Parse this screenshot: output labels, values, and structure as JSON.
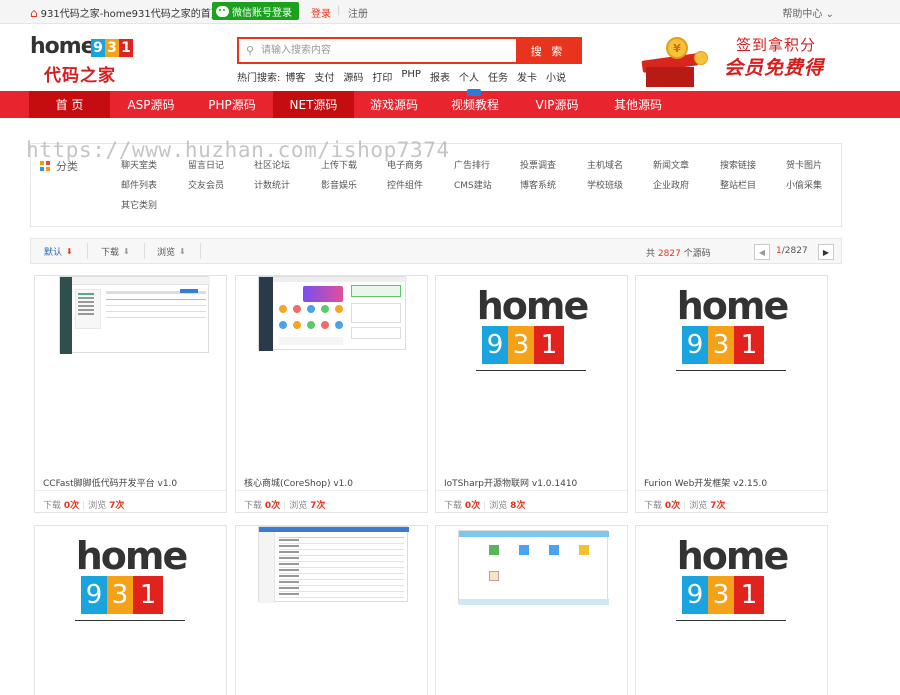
{
  "topbar": {
    "site_link": "931代码之家-home931代码之家的首页",
    "wechat_login": "微信账号登录",
    "login": "登录",
    "separator": "|",
    "register": "注册",
    "help": "帮助中心"
  },
  "logo": {
    "word": "home",
    "digits": [
      "9",
      "3",
      "1"
    ],
    "slogan": "代码之家"
  },
  "search": {
    "placeholder": "请输入搜索内容",
    "button": "搜 索",
    "hot_label": "热门搜索:",
    "hot_terms": [
      "博客",
      "支付",
      "源码",
      "打印",
      "PHP",
      "报表",
      "个人",
      "任务",
      "发卡",
      "小说"
    ]
  },
  "promo": {
    "line1": "签到拿积分",
    "line2": "会员免费得",
    "coin": "¥"
  },
  "nav": {
    "items": [
      "首 页",
      "ASP源码",
      "PHP源码",
      "NET源码",
      "游戏源码",
      "视频教程",
      "VIP源码",
      "其他源码"
    ]
  },
  "watermark": "https://www.huzhan.com/ishop7374",
  "categories": {
    "title": "分类",
    "items": [
      "聊天室类",
      "留言日记",
      "社区论坛",
      "上传下载",
      "电子商务",
      "广告排行",
      "投票调查",
      "主机域名",
      "新闻文章",
      "搜索链接",
      "贺卡图片",
      "邮件列表",
      "交友会员",
      "计数统计",
      "影音娱乐",
      "控件组件",
      "CMS建站",
      "博客系统",
      "学校班级",
      "企业政府",
      "整站栏目",
      "小偷采集",
      "其它类别"
    ]
  },
  "filters": {
    "items": [
      {
        "label": "默认",
        "arrow": "⬇"
      },
      {
        "label": "下载",
        "arrow": "⬇"
      },
      {
        "label": "浏览",
        "arrow": "⬇"
      }
    ],
    "total_prefix": "共",
    "total_count": "2827",
    "total_suffix": "个源码",
    "prev": "◀",
    "next": "▶",
    "page_current": "1",
    "page_total": "/2827"
  },
  "cards": [
    {
      "title": "CCFast脚脚低代码开发平台 v1.0",
      "download_label": "下载",
      "downloads": "0次",
      "view_label": "浏览",
      "views": "7次"
    },
    {
      "title": "核心商城(CoreShop) v1.0",
      "download_label": "下载",
      "downloads": "0次",
      "view_label": "浏览",
      "views": "7次"
    },
    {
      "title": "IoTSharp开源物联网 v1.0.1410",
      "download_label": "下载",
      "downloads": "0次",
      "view_label": "浏览",
      "views": "8次"
    },
    {
      "title": "Furion Web开发框架 v2.15.0",
      "download_label": "下载",
      "downloads": "0次",
      "view_label": "浏览",
      "views": "7次"
    },
    {
      "title": "",
      "download_label": "",
      "downloads": "",
      "view_label": "",
      "views": ""
    },
    {
      "title": "",
      "download_label": "",
      "downloads": "",
      "view_label": "",
      "views": ""
    },
    {
      "title": "",
      "download_label": "",
      "downloads": "",
      "view_label": "",
      "views": ""
    },
    {
      "title": "",
      "download_label": "",
      "downloads": "",
      "view_label": "",
      "views": ""
    }
  ],
  "colors": {
    "brand_red": "#e8252f",
    "nav_active": "#c50d10",
    "accent_orange": "#e8341c",
    "wechat_green": "#1ca11f",
    "digit_blue": "#1aa4df",
    "digit_orange": "#f5a219",
    "digit_red": "#e2221d"
  }
}
